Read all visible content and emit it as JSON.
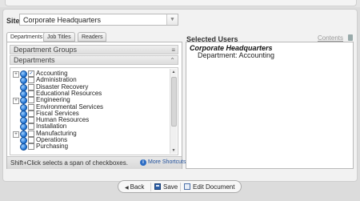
{
  "site": {
    "label": "Site",
    "value": "Corporate Headquarters"
  },
  "tabs": [
    {
      "label": "Departments"
    },
    {
      "label": "Job Titles"
    },
    {
      "label": "Readers"
    }
  ],
  "sections": {
    "department_groups": "Department Groups",
    "departments": "Departments"
  },
  "tree_items": [
    {
      "label": "Accounting",
      "expandable": true,
      "checked": true
    },
    {
      "label": "Administration",
      "expandable": false,
      "checked": false
    },
    {
      "label": "Disaster Recovery",
      "expandable": false,
      "checked": false
    },
    {
      "label": "Educational Resources",
      "expandable": false,
      "checked": false
    },
    {
      "label": "Engineering",
      "expandable": true,
      "checked": false
    },
    {
      "label": "Environmental Services",
      "expandable": false,
      "checked": false
    },
    {
      "label": "Fiscal Services",
      "expandable": false,
      "checked": false
    },
    {
      "label": "Human Resources",
      "expandable": false,
      "checked": false
    },
    {
      "label": "Installation",
      "expandable": false,
      "checked": false
    },
    {
      "label": "Manufacturing",
      "expandable": true,
      "checked": false
    },
    {
      "label": "Operations",
      "expandable": false,
      "checked": false
    },
    {
      "label": "Purchasing",
      "expandable": false,
      "checked": false
    }
  ],
  "footer": {
    "hint": "Shift+Click selects a span of checkboxes.",
    "more_shortcuts": "More Shortcuts"
  },
  "selected_users": {
    "title": "Selected Users",
    "contents_link": "Contents",
    "site": "Corporate Headquarters",
    "department": "Department: Accounting"
  },
  "toolbar": {
    "back": "Back",
    "save": "Save",
    "edit_document": "Edit Document"
  }
}
